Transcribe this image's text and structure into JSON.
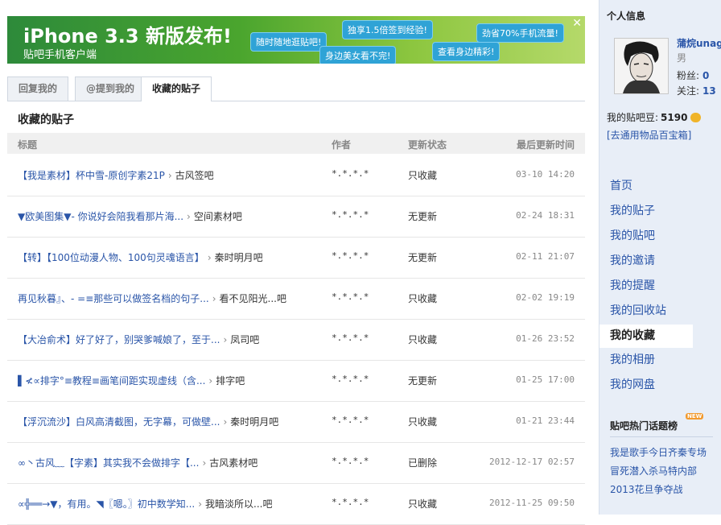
{
  "banner": {
    "title": "iPhone 3.3 新版发布!",
    "subtitle": "贴吧手机客户端",
    "bubbles": [
      "随时随地逛贴吧!",
      "独享1.5倍签到经验!",
      "身边美女看不完!",
      "劲省70%手机流量!",
      "查看身边精彩!"
    ],
    "close": "✕"
  },
  "tabs": [
    {
      "label": "回复我的"
    },
    {
      "label": "@提到我的"
    },
    {
      "label": "收藏的贴子"
    }
  ],
  "section_title": "收藏的贴子",
  "table": {
    "headers": {
      "title": "标题",
      "author": "作者",
      "status": "更新状态",
      "time": "最后更新时间"
    },
    "rows": [
      {
        "title": "【我是素材】杯中雪-原创字素21P",
        "forum": "古风签吧",
        "author": "*.*.*.*",
        "status": "只收藏",
        "time": "03-10 14:20"
      },
      {
        "title": "▼欧美图集▼- 你说好会陪我看那片海...",
        "forum": "空间素材吧",
        "author": "*.*.*.*",
        "status": "无更新",
        "time": "02-24 18:31"
      },
      {
        "title": "【转】【100位动漫人物、100句灵魂语言】",
        "forum": "秦时明月吧",
        "author": "*.*.*.*",
        "status": "无更新",
        "time": "02-11 21:07"
      },
      {
        "title": "再见秋暮』、- =≡那些可以做签名档的句子...",
        "forum": "看不见阳光...吧",
        "author": "*.*.*.*",
        "status": "只收藏",
        "time": "02-02 19:19"
      },
      {
        "title": "【大冶俞术】好了好了，别哭爹喊娘了，至于...",
        "forum": "凤司吧",
        "author": "*.*.*.*",
        "status": "只收藏",
        "time": "01-26 23:52"
      },
      {
        "title": "▌≮∝排字°≡教程≡画笔间距实现虚线（含...",
        "forum": "排字吧",
        "author": "*.*.*.*",
        "status": "无更新",
        "time": "01-25 17:00"
      },
      {
        "title": "【浮沉流沙】白风高清截图，无字幕，可做壁...",
        "forum": "秦时明月吧",
        "author": "*.*.*.*",
        "status": "只收藏",
        "time": "01-21 23:44"
      },
      {
        "title": "∞丶古风﹏【字素】其实我不会做排字【...",
        "forum": "古风素材吧",
        "author": "*.*.*.*",
        "status": "已删除",
        "time": "2012-12-17 02:57"
      },
      {
        "title": "∝╬══→▼，有用。◥〖嗯。〗初中数学知...",
        "forum": "我暗淡所以...吧",
        "author": "*.*.*.*",
        "status": "只收藏",
        "time": "2012-11-25 09:50"
      }
    ]
  },
  "sidebar": {
    "heading": "个人信息",
    "username": "蒲烷unag",
    "gender": "男",
    "fans_label": "粉丝:",
    "fans": "0",
    "follow_label": "关注:",
    "follow": "13",
    "beans_label": "我的贴吧豆:",
    "beans": "5190",
    "shop_link": "[去通用物品百宝箱]",
    "nav": [
      {
        "label": "首页"
      },
      {
        "label": "我的贴子"
      },
      {
        "label": "我的贴吧"
      },
      {
        "label": "我的邀请"
      },
      {
        "label": "我的提醒"
      },
      {
        "label": "我的回收站"
      },
      {
        "label": "我的收藏"
      },
      {
        "label": "我的相册"
      },
      {
        "label": "我的网盘"
      }
    ],
    "hot_heading": "贴吧热门话题榜",
    "hot_badge": "NEW",
    "hot_items": [
      "我是歌手今日齐秦专场",
      "冒死潜入杀马特内部",
      "2013花旦争夺战"
    ]
  },
  "colors": {
    "link": "#2a55a8",
    "sidebar_bg": "#e8eef7",
    "banner_green": "#4aa52e"
  }
}
